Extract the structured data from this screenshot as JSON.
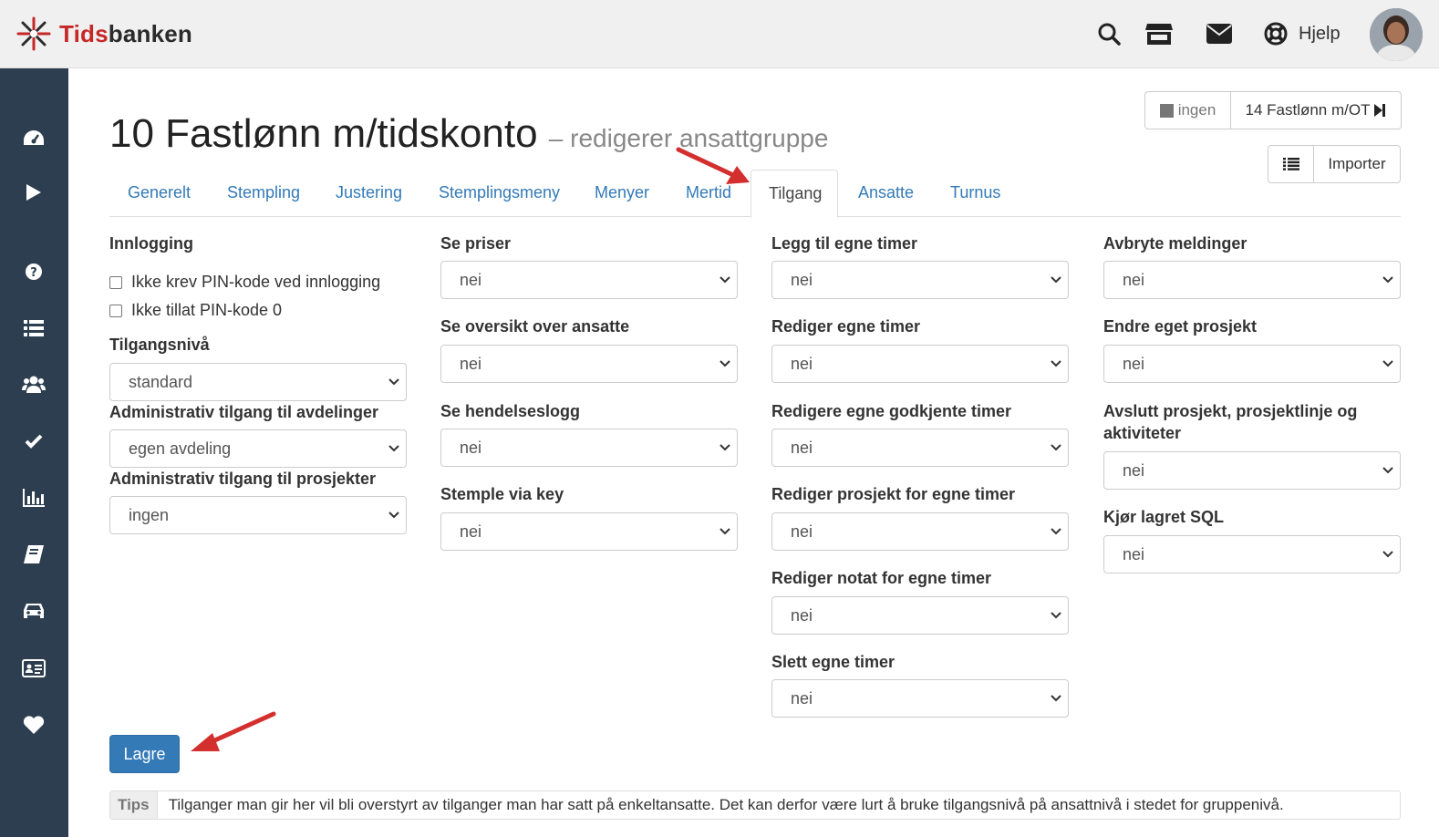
{
  "app": {
    "logo_part1": "Tids",
    "logo_part2": "banken",
    "help_label": "Hjelp"
  },
  "page": {
    "title": "10 Fastlønn m/tidskonto",
    "subtitle": "– redigerer ansattgruppe"
  },
  "nav_buttons": {
    "prev_label": "ingen",
    "next_label": "14 Fastlønn m/OT",
    "import_label": "Importer"
  },
  "tabs": [
    {
      "label": "Generelt"
    },
    {
      "label": "Stempling"
    },
    {
      "label": "Justering"
    },
    {
      "label": "Stemplingsmeny"
    },
    {
      "label": "Menyer"
    },
    {
      "label": "Mertid"
    },
    {
      "label": "Tilgang"
    },
    {
      "label": "Ansatte"
    },
    {
      "label": "Turnus"
    }
  ],
  "active_tab": "Tilgang",
  "login": {
    "heading": "Innlogging",
    "checkboxes": [
      {
        "label": "Ikke krev PIN-kode ved innlogging",
        "checked": false
      },
      {
        "label": "Ikke tillat PIN-kode 0",
        "checked": false
      }
    ]
  },
  "fields": {
    "tilgangsniva": {
      "label": "Tilgangsnivå",
      "value": "standard"
    },
    "admin_avdelinger": {
      "label": "Administrativ tilgang til avdelinger",
      "value": "egen avdeling"
    },
    "admin_prosjekter": {
      "label": "Administrativ tilgang til prosjekter",
      "value": "ingen"
    },
    "se_priser": {
      "label": "Se priser",
      "value": "nei"
    },
    "se_oversikt": {
      "label": "Se oversikt over ansatte",
      "value": "nei"
    },
    "se_hendelseslogg": {
      "label": "Se hendelseslogg",
      "value": "nei"
    },
    "stemple_key": {
      "label": "Stemple via key",
      "value": "nei"
    },
    "legg_til_timer": {
      "label": "Legg til egne timer",
      "value": "nei"
    },
    "rediger_timer": {
      "label": "Rediger egne timer",
      "value": "nei"
    },
    "redigere_godkjente": {
      "label": "Redigere egne godkjente timer",
      "value": "nei"
    },
    "rediger_prosjekt": {
      "label": "Rediger prosjekt for egne timer",
      "value": "nei"
    },
    "rediger_notat": {
      "label": "Rediger notat for egne timer",
      "value": "nei"
    },
    "slett_timer": {
      "label": "Slett egne timer",
      "value": "nei"
    },
    "avbryte_meldinger": {
      "label": "Avbryte meldinger",
      "value": "nei"
    },
    "endre_prosjekt": {
      "label": "Endre eget prosjekt",
      "value": "nei"
    },
    "avslutt_prosjekt": {
      "label_line1": "Avslutt prosjekt, prosjektlinje og",
      "label_line2": "aktiviteter",
      "value": "nei"
    },
    "kjor_sql": {
      "label": "Kjør lagret SQL",
      "value": "nei"
    }
  },
  "save_label": "Lagre",
  "tips": {
    "label": "Tips",
    "text": "Tilganger man gir her vil bli overstyrt av tilganger man har satt på enkeltansatte. Det kan derfor være lurt å bruke tilgangsnivå på ansattnivå i stedet for gruppenivå."
  },
  "colors": {
    "sidebar": "#2c3e50",
    "link": "#337ab7",
    "primary_button": "#337ab7",
    "logo_red": "#c62828",
    "annotation_arrow": "#d32f2f"
  },
  "icons": {
    "topbar": [
      "search-icon",
      "store-icon",
      "envelope-icon",
      "lifebuoy-icon"
    ],
    "sidebar": [
      "dashboard-icon",
      "play-icon",
      "question-icon",
      "list-icon",
      "users-icon",
      "check-icon",
      "bar-chart-icon",
      "book-icon",
      "car-icon",
      "id-card-icon",
      "heart-icon"
    ]
  }
}
